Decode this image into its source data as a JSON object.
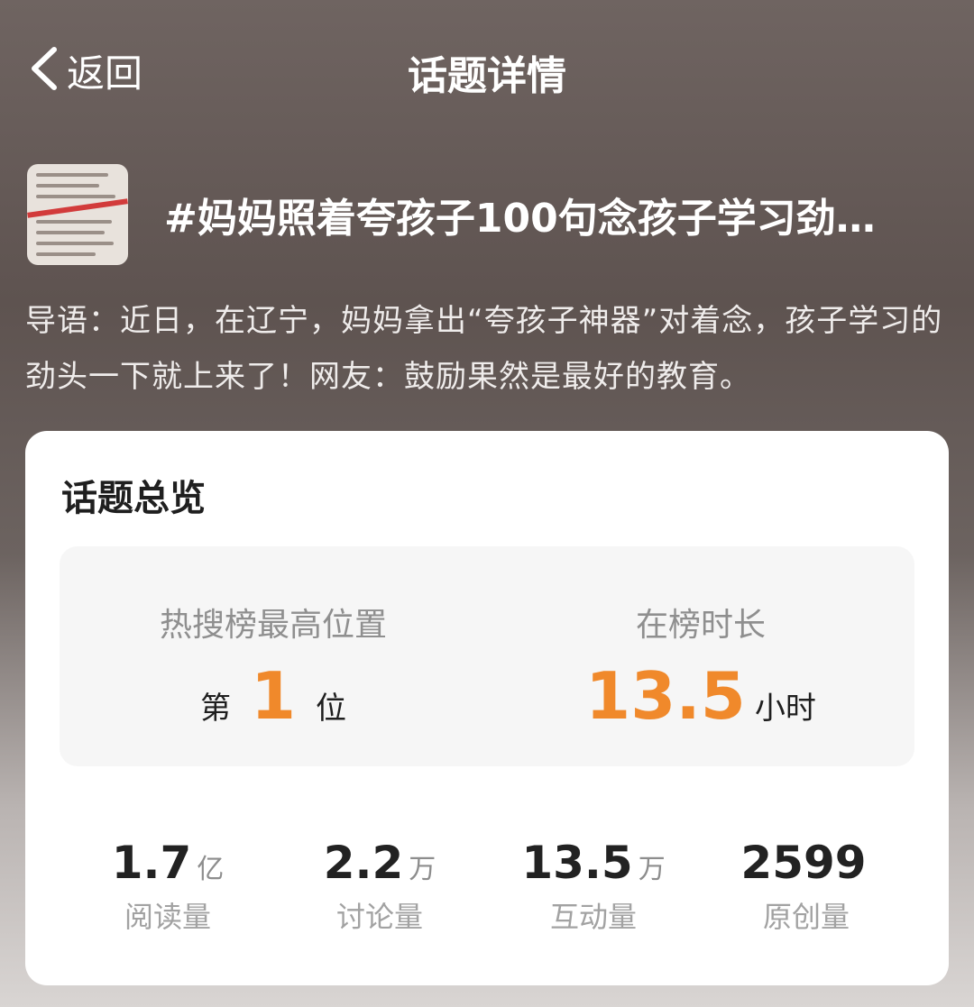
{
  "header": {
    "back_label": "返回",
    "title": "话题详情"
  },
  "topic": {
    "title": "#妈妈照着夸孩子100句念孩子学习劲…",
    "intro": "导语：近日，在辽宁，妈妈拿出“夸孩子神器”对着念，孩子学习的劲头一下就上来了！网友：鼓励果然是最好的教育。"
  },
  "overview": {
    "title": "话题总览",
    "rank": {
      "label": "热搜榜最高位置",
      "prefix": "第",
      "value": "1",
      "suffix": "位"
    },
    "duration": {
      "label": "在榜时长",
      "value": "13.5",
      "unit": "小时"
    },
    "metrics": [
      {
        "value": "1.7",
        "unit": "亿",
        "label": "阅读量"
      },
      {
        "value": "2.2",
        "unit": "万",
        "label": "讨论量"
      },
      {
        "value": "13.5",
        "unit": "万",
        "label": "互动量"
      },
      {
        "value": "2599",
        "unit": "",
        "label": "原创量"
      }
    ]
  },
  "colors": {
    "accent": "#f0892b",
    "card_bg": "#ffffff",
    "stats_bg": "#f6f6f6"
  }
}
